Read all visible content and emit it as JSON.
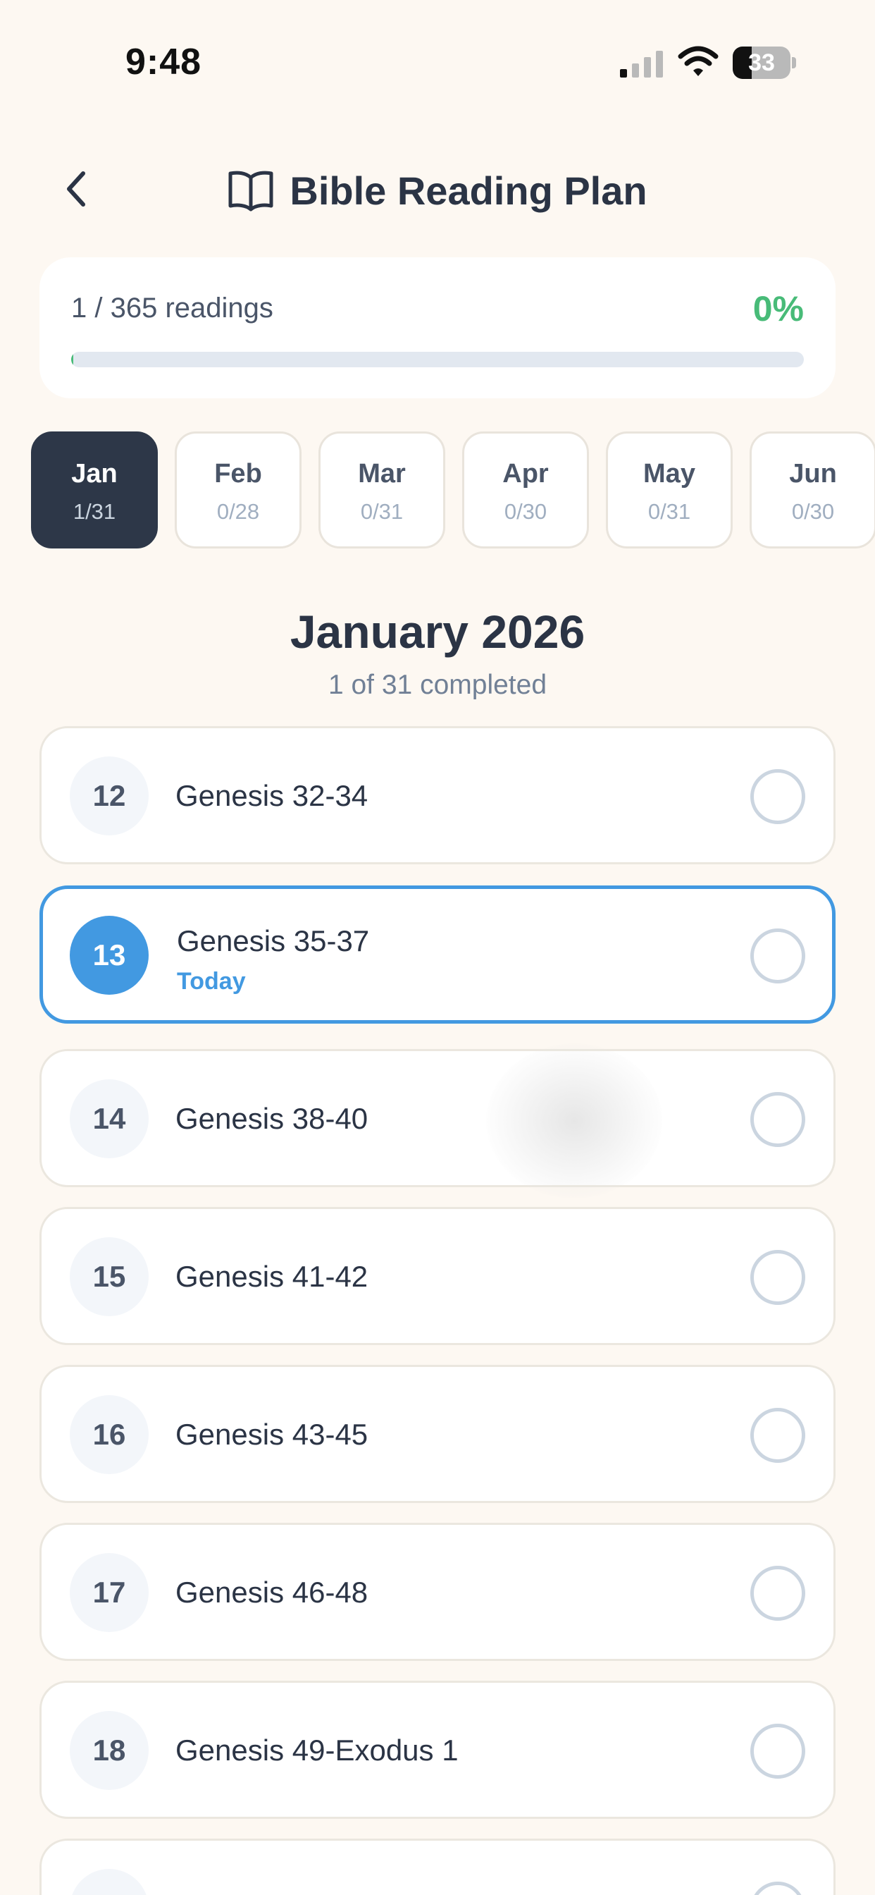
{
  "status_bar": {
    "time": "9:48",
    "battery": "33",
    "battery_level": 0.33
  },
  "header": {
    "title": "Bible Reading Plan",
    "back_icon": "chevron-left-icon",
    "title_icon": "open-book-icon"
  },
  "progress": {
    "label": "1 / 365 readings",
    "percent": "0%",
    "fraction": 0.003
  },
  "months": [
    {
      "name": "Jan",
      "count": "1/31",
      "active": true
    },
    {
      "name": "Feb",
      "count": "0/28",
      "active": false
    },
    {
      "name": "Mar",
      "count": "0/31",
      "active": false
    },
    {
      "name": "Apr",
      "count": "0/30",
      "active": false
    },
    {
      "name": "May",
      "count": "0/31",
      "active": false
    },
    {
      "name": "Jun",
      "count": "0/30",
      "active": false
    }
  ],
  "month_view": {
    "title": "January 2026",
    "subtitle": "1 of 31 completed"
  },
  "readings": [
    {
      "day": "12",
      "passage": "Genesis 32-34",
      "today": false,
      "completed": false
    },
    {
      "day": "13",
      "passage": "Genesis 35-37",
      "today": true,
      "today_label": "Today",
      "completed": false
    },
    {
      "day": "14",
      "passage": "Genesis 38-40",
      "today": false,
      "completed": false
    },
    {
      "day": "15",
      "passage": "Genesis 41-42",
      "today": false,
      "completed": false
    },
    {
      "day": "16",
      "passage": "Genesis 43-45",
      "today": false,
      "completed": false
    },
    {
      "day": "17",
      "passage": "Genesis 46-48",
      "today": false,
      "completed": false
    },
    {
      "day": "18",
      "passage": "Genesis 49-Exodus 1",
      "today": false,
      "completed": false
    }
  ],
  "colors": {
    "background": "#fdf8f2",
    "accent": "#4299e1",
    "success": "#48bb78",
    "dark": "#2d3748"
  }
}
